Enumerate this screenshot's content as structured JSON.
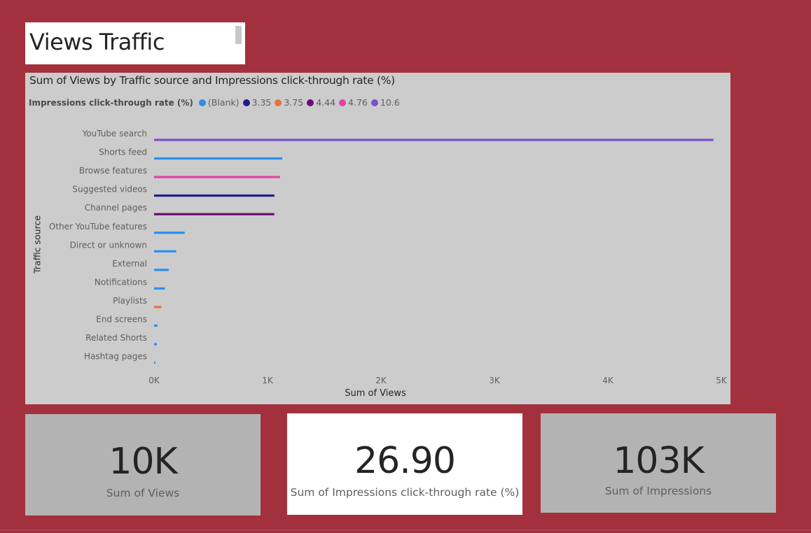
{
  "page": {
    "title": "Views Traffic"
  },
  "colors": {
    "background": "#a3313d",
    "chart_panel": "#cccccc",
    "blank": "#2a8ff0",
    "3.35": "#1a1e8c",
    "3.75": "#e6713f",
    "4.44": "#6b0b78",
    "4.76": "#e044a7",
    "10.6": "#7b4fd0"
  },
  "legend": {
    "title": "Impressions click-through rate (%)",
    "items": [
      {
        "label": "(Blank)",
        "color": "#2a8ff0"
      },
      {
        "label": "3.35",
        "color": "#1a1e8c"
      },
      {
        "label": "3.75",
        "color": "#e6713f"
      },
      {
        "label": "4.44",
        "color": "#6b0b78"
      },
      {
        "label": "4.76",
        "color": "#e044a7"
      },
      {
        "label": "10.6",
        "color": "#7b4fd0"
      }
    ]
  },
  "chart_data": {
    "type": "bar",
    "orientation": "horizontal",
    "title": "Sum of Views by Traffic source and Impressions click-through rate (%)",
    "xlabel": "Sum of Views",
    "ylabel": "Traffic source",
    "xlim": [
      0,
      5000
    ],
    "x_ticks": [
      "0K",
      "1K",
      "2K",
      "3K",
      "4K",
      "5K"
    ],
    "legend_position": "top-left",
    "categories": [
      "YouTube search",
      "Shorts feed",
      "Browse features",
      "Suggested videos",
      "Channel pages",
      "Other YouTube features",
      "Direct or unknown",
      "External",
      "Notifications",
      "Playlists",
      "End screens",
      "Related Shorts",
      "Hashtag pages"
    ],
    "series": [
      {
        "name": "(Blank)",
        "color": "#2a8ff0",
        "values": [
          null,
          1130,
          null,
          null,
          null,
          270,
          195,
          130,
          95,
          null,
          30,
          25,
          10
        ]
      },
      {
        "name": "3.35",
        "color": "#1a1e8c",
        "values": [
          null,
          null,
          null,
          1060,
          null,
          null,
          null,
          null,
          null,
          null,
          null,
          null,
          null
        ]
      },
      {
        "name": "3.75",
        "color": "#e6713f",
        "values": [
          null,
          null,
          null,
          null,
          null,
          null,
          null,
          null,
          null,
          65,
          null,
          null,
          null
        ]
      },
      {
        "name": "4.44",
        "color": "#6b0b78",
        "values": [
          null,
          null,
          null,
          null,
          1060,
          null,
          null,
          null,
          null,
          null,
          null,
          null,
          null
        ]
      },
      {
        "name": "4.76",
        "color": "#e044a7",
        "values": [
          null,
          null,
          1110,
          null,
          null,
          null,
          null,
          null,
          null,
          null,
          null,
          null,
          null
        ]
      },
      {
        "name": "10.6",
        "color": "#7b4fd0",
        "values": [
          4930,
          null,
          null,
          null,
          null,
          null,
          null,
          null,
          null,
          null,
          null,
          null,
          null
        ]
      }
    ]
  },
  "cards": [
    {
      "value": "10K",
      "label": "Sum of Views"
    },
    {
      "value": "26.90",
      "label": "Sum of Impressions click-through rate (%)"
    },
    {
      "value": "103K",
      "label": "Sum of Impressions"
    }
  ]
}
